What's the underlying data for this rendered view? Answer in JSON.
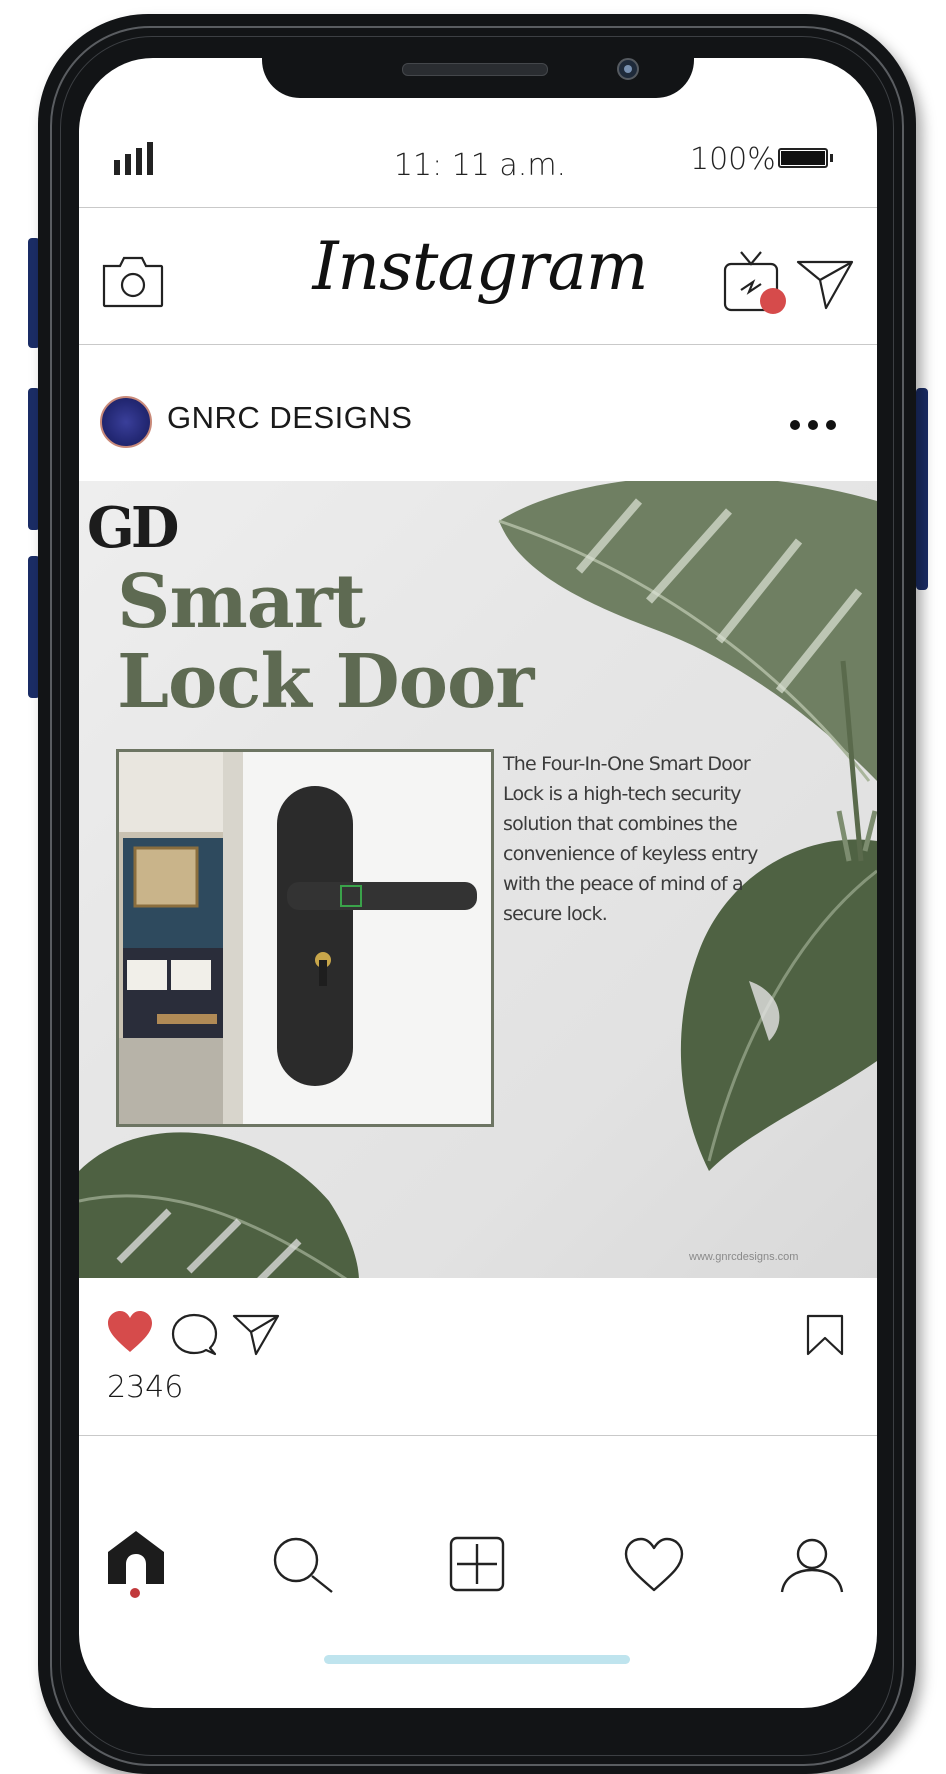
{
  "status_bar": {
    "time": "11: 11 a.m.",
    "battery": "100%",
    "signal_icon": "signal-bars-icon",
    "battery_icon": "battery-full-icon"
  },
  "header": {
    "title": "Instagram",
    "icons": [
      "camera-icon",
      "igtv-icon",
      "direct-message-icon"
    ]
  },
  "post": {
    "username": "GNRC DESIGNS",
    "image": {
      "logo_text": "GD",
      "title_line1": "Smart",
      "title_line2": "Lock Door",
      "description": "The Four-In-One Smart Door Lock is a high-tech security solution that combines the convenience of keyless entry with the peace of mind of a secure lock.",
      "website": "www.gnrcdesigns.com"
    },
    "likes": "2346",
    "liked": true
  },
  "bottom_nav": {
    "items": [
      "home-icon",
      "search-icon",
      "add-post-icon",
      "activity-heart-icon",
      "profile-icon"
    ],
    "active": "home"
  },
  "colors": {
    "like_red": "#d64b4b",
    "frame_dark": "#121416",
    "side_buttons": "#1b2d66",
    "title_green": "#5e6a52",
    "home_indicator": "#bfe4ee"
  }
}
